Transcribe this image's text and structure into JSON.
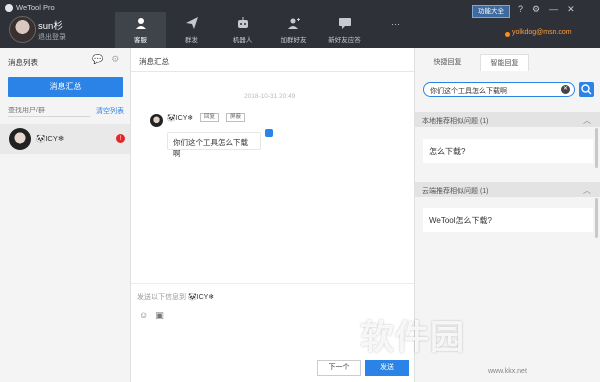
{
  "app": {
    "title": "WeTool Pro"
  },
  "user": {
    "name": "sun杉",
    "logout": "退出登录",
    "email": "yolkdog@msn.com"
  },
  "topbar": {
    "func_button": "功能大全",
    "icons": [
      "help-icon",
      "settings-icon",
      "minimize-icon",
      "close-icon"
    ],
    "tabs": [
      {
        "label": "客服",
        "icon": "customer-service-icon",
        "active": true
      },
      {
        "label": "群发",
        "icon": "send-icon",
        "active": false
      },
      {
        "label": "机器人",
        "icon": "robot-icon",
        "active": false
      },
      {
        "label": "加群好友",
        "icon": "add-friend-icon",
        "active": false
      },
      {
        "label": "新好友应答",
        "icon": "message-icon",
        "active": false
      },
      {
        "label": "···",
        "icon": "more-icon",
        "active": false
      }
    ]
  },
  "left": {
    "title": "消息列表",
    "summary_button": "消息汇总",
    "search_placeholder": "查找用户/群",
    "clear_list": "清空列表",
    "contacts": [
      {
        "name": "🐼ICY❄",
        "badge": "!"
      }
    ]
  },
  "middle": {
    "title": "消息汇总",
    "timestamp": "2018-10-31 20:49",
    "message": {
      "sender": "🐼ICY❄",
      "reply_tag": "回复",
      "block_tag": "屏蔽",
      "text": "你们这个工具怎么下载啊"
    },
    "compose_hint_prefix": "发送以下信息到",
    "compose_hint_target": "🐼ICY❄",
    "next_button": "下一个",
    "send_button": "发送"
  },
  "right": {
    "tabs": [
      "快捷回复",
      "智能回复"
    ],
    "active_tab": "智能回复",
    "search_value": "你们这个工具怎么下载啊",
    "local_section": {
      "title": "本地推荐相似问题",
      "count": "(1)",
      "answer": "怎么下载?"
    },
    "cloud_section": {
      "title": "云端推荐相似问题",
      "count": "(1)",
      "answer": "WeTool怎么下载?"
    }
  },
  "watermark": {
    "text": "软件园",
    "url": "www.kkx.net"
  },
  "colors": {
    "topbar": "#2e3238",
    "accent": "#2b83e8",
    "email": "#ff9d3a",
    "badge": "#e52727"
  }
}
